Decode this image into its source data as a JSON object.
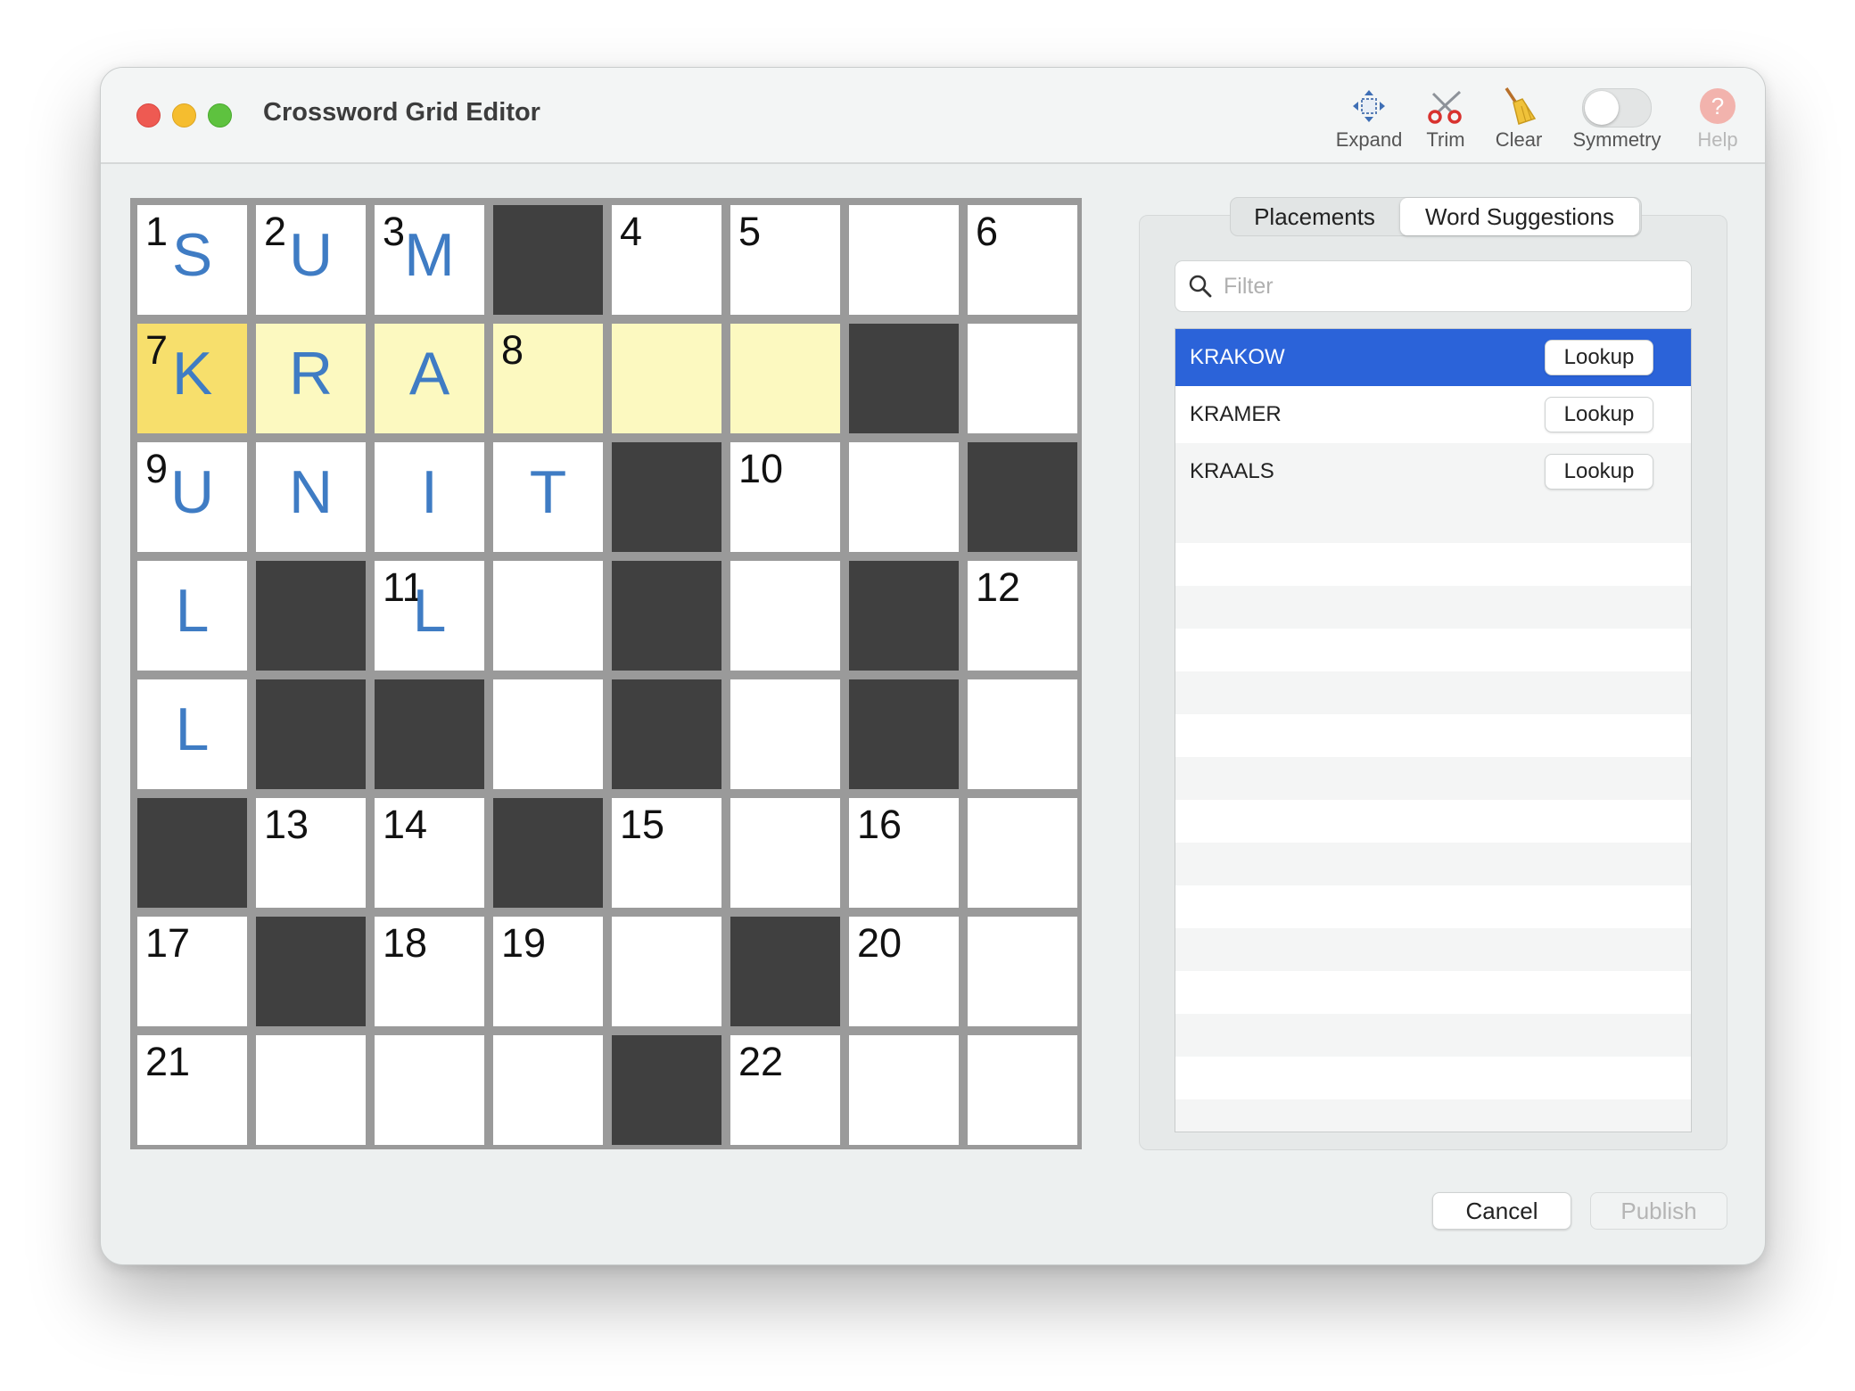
{
  "window": {
    "title": "Crossword Grid Editor"
  },
  "toolbar": {
    "expand": "Expand",
    "trim": "Trim",
    "clear": "Clear",
    "symmetry": "Symmetry",
    "help": "Help"
  },
  "grid": {
    "rows": [
      [
        {
          "n": "1",
          "l": "S"
        },
        {
          "n": "2",
          "l": "U"
        },
        {
          "n": "3",
          "l": "M"
        },
        {
          "b": 1
        },
        {
          "n": "4"
        },
        {
          "n": "5"
        },
        {},
        {
          "n": "6"
        }
      ],
      [
        {
          "n": "7",
          "l": "K",
          "cursor": 1
        },
        {
          "l": "R",
          "hl": 1
        },
        {
          "l": "A",
          "hl": 1
        },
        {
          "n": "8",
          "hl": 1
        },
        {
          "hl": 1
        },
        {
          "hl": 1
        },
        {
          "b": 1
        },
        {}
      ],
      [
        {
          "n": "9",
          "l": "U"
        },
        {
          "l": "N"
        },
        {
          "l": "I"
        },
        {
          "l": "T"
        },
        {
          "b": 1
        },
        {
          "n": "10"
        },
        {},
        {
          "b": 1
        }
      ],
      [
        {
          "l": "L"
        },
        {
          "b": 1
        },
        {
          "n": "11",
          "l": "L"
        },
        {},
        {
          "b": 1
        },
        {},
        {
          "b": 1
        },
        {
          "n": "12"
        }
      ],
      [
        {
          "l": "L"
        },
        {
          "b": 1
        },
        {
          "b": 1
        },
        {},
        {
          "b": 1
        },
        {},
        {
          "b": 1
        },
        {}
      ],
      [
        {
          "b": 1
        },
        {
          "n": "13"
        },
        {
          "n": "14"
        },
        {
          "b": 1
        },
        {
          "n": "15"
        },
        {},
        {
          "n": "16"
        },
        {}
      ],
      [
        {
          "n": "17"
        },
        {
          "b": 1
        },
        {
          "n": "18"
        },
        {
          "n": "19"
        },
        {},
        {
          "b": 1
        },
        {
          "n": "20"
        },
        {}
      ],
      [
        {
          "n": "21"
        },
        {},
        {},
        {},
        {
          "b": 1
        },
        {
          "n": "22"
        },
        {},
        {}
      ]
    ]
  },
  "tabs": {
    "placements": "Placements",
    "suggestions": "Word Suggestions"
  },
  "filter": {
    "placeholder": "Filter"
  },
  "suggestions": {
    "lookup_label": "Lookup",
    "words": [
      "KRAKOW",
      "KRAMER",
      "KRAALS"
    ]
  },
  "buttons": {
    "cancel": "Cancel",
    "publish": "Publish"
  },
  "colors": {
    "accent": "#2b63d9",
    "letter": "#3f7cc4",
    "highlight": "#fcf9c0",
    "cursor": "#f7df6c",
    "block": "#404040"
  }
}
